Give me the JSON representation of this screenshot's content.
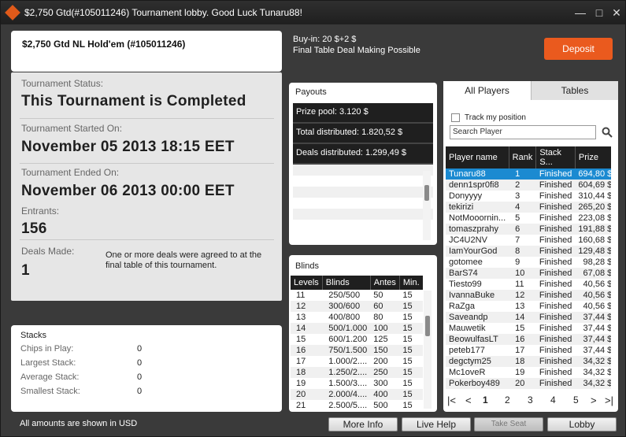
{
  "window": {
    "title": "$2,750 Gtd(#105011246) Tournament lobby. Good Luck Tunaru88!",
    "minimize": "—",
    "maximize": "□",
    "close": "✕"
  },
  "header": {
    "tournament_name": "$2,750 Gtd NL Hold'em (#105011246)",
    "buyin": "Buy-in: 20 $+2 $",
    "subtitle": "Final Table Deal Making Possible",
    "deposit_label": "Deposit"
  },
  "status": {
    "status_label": "Tournament Status:",
    "status_value": "This Tournament is Completed",
    "started_label": "Tournament Started On:",
    "started_value": "November 05 2013   18:15 EET",
    "ended_label": "Tournament Ended On:",
    "ended_value": "November 06 2013   00:00 EET",
    "entrants_label": "Entrants:",
    "entrants_value": "156",
    "deals_label": "Deals Made:",
    "deals_value": "1",
    "deals_note": "One or more deals were agreed to at the final table of this tournament."
  },
  "stacks": {
    "title": "Stacks",
    "rows": [
      {
        "label": "Chips in Play:",
        "value": "0"
      },
      {
        "label": "Largest Stack:",
        "value": "0"
      },
      {
        "label": "Average Stack:",
        "value": "0"
      },
      {
        "label": "Smallest Stack:",
        "value": "0"
      }
    ]
  },
  "footer_note": "All amounts are shown in USD",
  "payouts": {
    "title": "Payouts",
    "rows": [
      "Prize pool: 3.120 $",
      "Total distributed: 1.820,52 $",
      "Deals distributed: 1.299,49 $"
    ]
  },
  "blinds": {
    "title": "Blinds",
    "headers": [
      "Levels",
      "Blinds",
      "Antes",
      "Min."
    ],
    "rows": [
      [
        "11",
        "250/500",
        "50",
        "15"
      ],
      [
        "12",
        "300/600",
        "60",
        "15"
      ],
      [
        "13",
        "400/800",
        "80",
        "15"
      ],
      [
        "14",
        "500/1.000",
        "100",
        "15"
      ],
      [
        "15",
        "600/1.200",
        "125",
        "15"
      ],
      [
        "16",
        "750/1.500",
        "150",
        "15"
      ],
      [
        "17",
        "1.000/2....",
        "200",
        "15"
      ],
      [
        "18",
        "1.250/2....",
        "250",
        "15"
      ],
      [
        "19",
        "1.500/3....",
        "300",
        "15"
      ],
      [
        "20",
        "2.000/4....",
        "400",
        "15"
      ],
      [
        "21",
        "2.500/5....",
        "500",
        "15"
      ]
    ]
  },
  "players": {
    "tab_all": "All Players",
    "tab_tables": "Tables",
    "track_label": "Track my position",
    "search_placeholder": "Search Player",
    "headers": [
      "Player name",
      "Rank",
      "Stack S...",
      "Prize"
    ],
    "rows": [
      [
        "Tunaru88",
        "1",
        "Finished",
        "694,80 $"
      ],
      [
        "denn1spr0fi8",
        "2",
        "Finished",
        "604,69 $"
      ],
      [
        "Donyyyy",
        "3",
        "Finished",
        "310,44 $"
      ],
      [
        "tekirizi",
        "4",
        "Finished",
        "265,20 $"
      ],
      [
        "NotMooornin...",
        "5",
        "Finished",
        "223,08 $"
      ],
      [
        "tomaszprahy",
        "6",
        "Finished",
        "191,88 $"
      ],
      [
        "JC4U2NV",
        "7",
        "Finished",
        "160,68 $"
      ],
      [
        "IamYourGod",
        "8",
        "Finished",
        "129,48 $"
      ],
      [
        "gotomee",
        "9",
        "Finished",
        "98,28 $"
      ],
      [
        "BarS74",
        "10",
        "Finished",
        "67,08 $"
      ],
      [
        "Tiesto99",
        "11",
        "Finished",
        "40,56 $"
      ],
      [
        "IvannaBuke",
        "12",
        "Finished",
        "40,56 $"
      ],
      [
        "RaZga",
        "13",
        "Finished",
        "40,56 $"
      ],
      [
        "Saveandp",
        "14",
        "Finished",
        "37,44 $"
      ],
      [
        "Mauwetik",
        "15",
        "Finished",
        "37,44 $"
      ],
      [
        "BeowulfasLT",
        "16",
        "Finished",
        "37,44 $"
      ],
      [
        "peteb177",
        "17",
        "Finished",
        "37,44 $"
      ],
      [
        "degctym25",
        "18",
        "Finished",
        "34,32 $"
      ],
      [
        "Mc1oveR",
        "19",
        "Finished",
        "34,32 $"
      ],
      [
        "Pokerboy489",
        "20",
        "Finished",
        "34,32 $"
      ]
    ],
    "pages": [
      "1",
      "2",
      "3",
      "4",
      "5"
    ]
  },
  "footer_buttons": {
    "more_info": "More Info",
    "live_help": "Live Help",
    "take_seat": "Take Seat",
    "lobby": "Lobby"
  }
}
